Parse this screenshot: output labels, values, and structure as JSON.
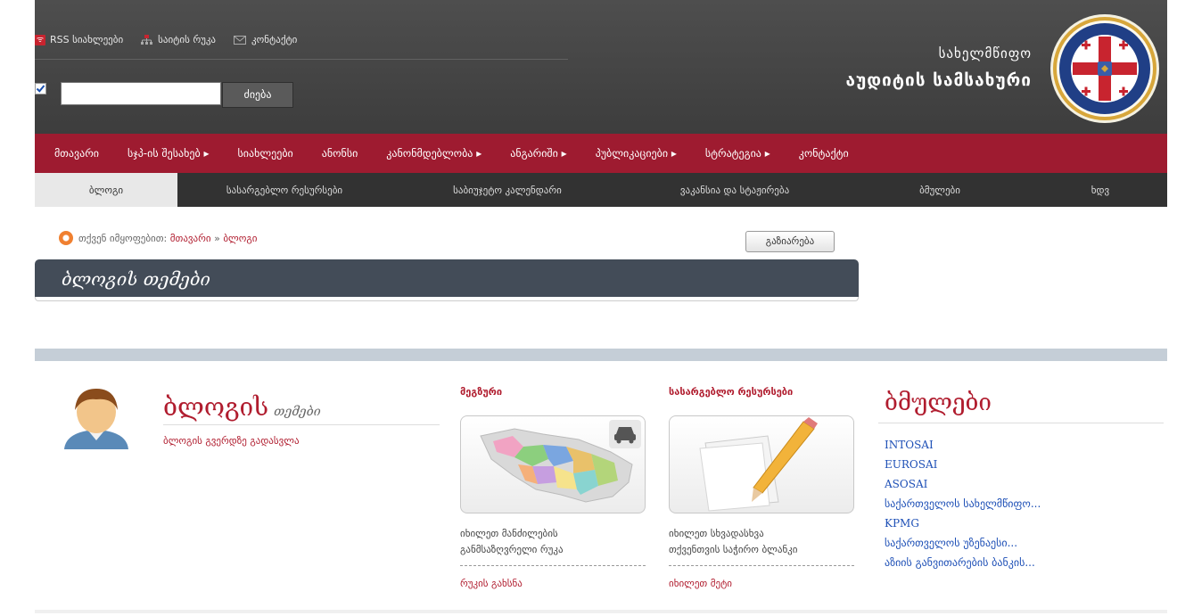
{
  "header": {
    "top_links": [
      {
        "label": "RSS სიახლეები",
        "icon": "rss-icon"
      },
      {
        "label": "საიტის რუკა",
        "icon": "sitemap-icon"
      },
      {
        "label": "კონტაქტი",
        "icon": "mail-icon"
      }
    ],
    "search": {
      "value": "",
      "placeholder": "",
      "button": "ძიება"
    },
    "org_line1": "სახელმწიფო",
    "org_line2": "აუდიტის სამსახური"
  },
  "main_nav": [
    {
      "label": "მთავარი"
    },
    {
      "label": "სჯპ-ის შესახებ ▸"
    },
    {
      "label": "სიახლეები"
    },
    {
      "label": "ანონსი"
    },
    {
      "label": "კანონმდებლობა ▸"
    },
    {
      "label": "ანგარიში ▸"
    },
    {
      "label": "პუბლიკაციები ▸"
    },
    {
      "label": "სტრატეგია ▸"
    },
    {
      "label": "კონტაქტი"
    }
  ],
  "sub_nav": [
    {
      "label": "ბლოგი"
    },
    {
      "label": "სასარგებლო რესურსები"
    },
    {
      "label": "საბიუჯეტო კალენდარი"
    },
    {
      "label": "ვაკანსია და სტაჟირება"
    },
    {
      "label": "ბმულები"
    },
    {
      "label": "ხდვ"
    }
  ],
  "breadcrumb": {
    "prefix": "თქვენ იმყოფებით:",
    "home": "მთავარი",
    "sep": "»",
    "current": "ბლოგი"
  },
  "share_button": "გაზიარება",
  "page_title": "ბლოგის თემები",
  "blog": {
    "title": "ბლოგის",
    "subtitle": "თემები",
    "link": "ბლოგის გვერდზე გადასვლა"
  },
  "map_section": {
    "heading": "მეგზური",
    "text1": "იხილეთ მანძილების",
    "text2": "განმსაზღვრელი რუკა",
    "link": "რუკის გახსნა"
  },
  "resources_section": {
    "heading": "სასარგებლო რესურსები",
    "text1": "იხილეთ სხვადასხვა",
    "text2": "თქვენთვის საჭირო ბლანკი",
    "link": "იხილეთ მეტი"
  },
  "links_section": {
    "heading": "ბმულები",
    "items": [
      "INTOSAI",
      "EUROSAI",
      "ASOSAI",
      "საქართველოს სახელმწიფო...",
      "KPMG",
      "საქართველოს უზენაესი...",
      "აზიის განვითარების ბანკის..."
    ]
  }
}
